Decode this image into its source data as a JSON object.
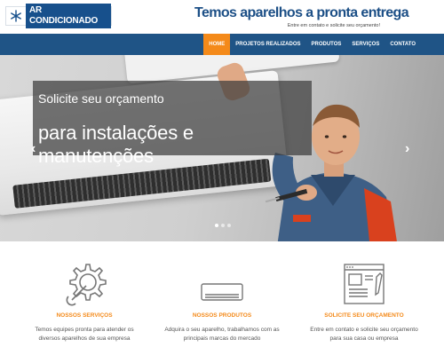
{
  "header": {
    "logo_text": "AR CONDICIONADO",
    "tagline": "Temos aparelhos a pronta entrega",
    "subtagline": "Entre em contato e solicite seu orçamento!"
  },
  "nav": {
    "items": [
      {
        "label": "HOME",
        "active": true
      },
      {
        "label": "PROJETOS REALIZADOS",
        "active": false
      },
      {
        "label": "PRODUTOS",
        "active": false
      },
      {
        "label": "SERVIÇOS",
        "active": false
      },
      {
        "label": "CONTATO",
        "active": false
      }
    ]
  },
  "hero": {
    "caption_line1": "Solicite seu orçamento",
    "caption_line2": "para instalações e manutenções",
    "prev_arrow": "‹",
    "next_arrow": "›",
    "slides": 3,
    "active_slide": 1
  },
  "features": [
    {
      "icon": "gear-wrench-icon",
      "title": "NOSSOS SERVIÇOS",
      "text": "Temos equipes pronta para atender os diversos aparelhos de sua empresa"
    },
    {
      "icon": "air-conditioner-icon",
      "title": "NOSSOS PRODUTOS",
      "text": "Adquira o seu aparelho, trabalhamos com as principais marcas do mercado"
    },
    {
      "icon": "quote-form-icon",
      "title": "SOLICITE SEU ORÇAMENTO",
      "text": "Entre em contato e solicite seu orçamento para sua casa ou empresa"
    }
  ],
  "colors": {
    "brand_blue": "#1f5486",
    "accent_orange": "#f48a1a"
  }
}
